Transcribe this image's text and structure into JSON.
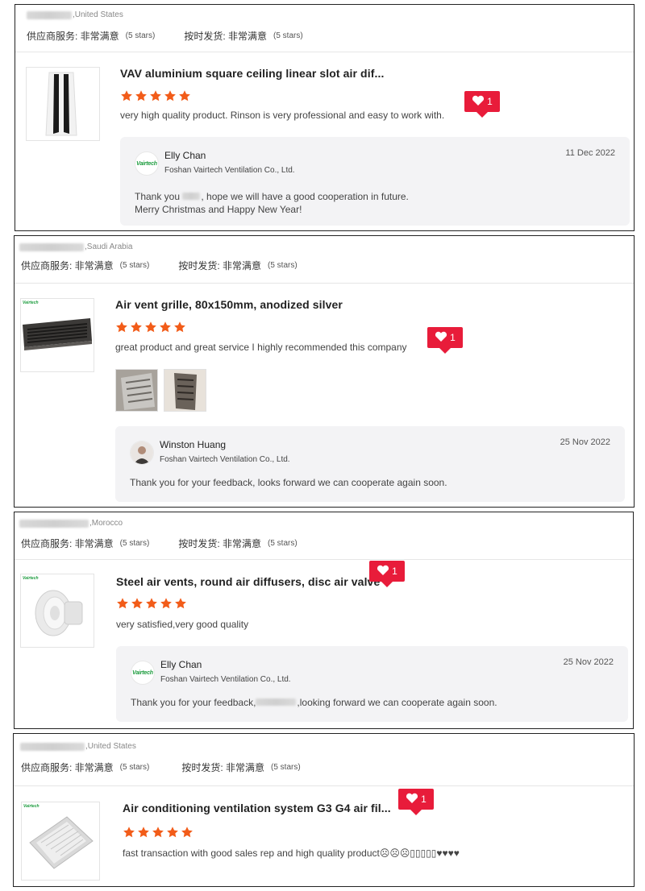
{
  "colors": {
    "star": "#f25c19",
    "like": "#e81c3a",
    "reply_bg": "#f3f3f5",
    "brand_green": "#1a9b3c"
  },
  "brand_logo_text": "Vairtech",
  "reviews": [
    {
      "location": ",United States",
      "service_label": "供应商服务: 非常满意",
      "service_stars": "(5 stars)",
      "shipping_label": "按时发货: 非常满意",
      "shipping_stars": "(5 stars)",
      "product_title": "VAV aluminium square ceiling linear slot air dif...",
      "rating": 5,
      "comment": "very high quality product.  Rinson is very professional and easy to work with.",
      "likes": "1",
      "reply": {
        "name": "Elly Chan",
        "company": "Foshan Vairtech Ventilation Co., Ltd.",
        "date": "11 Dec 2022",
        "line1_a": "Thank you ",
        "line1_b": ", hope we will have a good cooperation in future.",
        "line2": "Merry Christmas and Happy New Year!"
      }
    },
    {
      "location": ",Saudi Arabia",
      "service_label": "供应商服务: 非常满意",
      "service_stars": "(5 stars)",
      "shipping_label": "按时发货: 非常满意",
      "shipping_stars": "(5 stars)",
      "product_title": "Air vent grille, 80x150mm, anodized silver",
      "rating": 5,
      "comment": "great product and great service I highly recommended this company",
      "likes": "1",
      "reply": {
        "name": "Winston Huang",
        "company": "Foshan Vairtech Ventilation Co., Ltd.",
        "date": "25 Nov 2022",
        "line1": "Thank you for your feedback, looks forward we can cooperate again soon."
      }
    },
    {
      "location": ",Morocco",
      "service_label": "供应商服务: 非常满意",
      "service_stars": "(5 stars)",
      "shipping_label": "按时发货: 非常满意",
      "shipping_stars": "(5 stars)",
      "product_title": "Steel air vents, round air diffusers, disc air valve",
      "rating": 5,
      "comment": "very satisfied,very good quality",
      "likes": "1",
      "reply": {
        "name": "Elly Chan",
        "company": "Foshan Vairtech Ventilation Co., Ltd.",
        "date": "25 Nov 2022",
        "line1_a": "Thank you for your feedback,",
        "line1_b": ",looking forward we can cooperate again soon."
      }
    },
    {
      "location": ",United States",
      "service_label": "供应商服务: 非常满意",
      "service_stars": "(5 stars)",
      "shipping_label": "按时发货: 非常满意",
      "shipping_stars": "(5 stars)",
      "product_title": "Air conditioning ventilation system G3 G4 air fil...",
      "rating": 5,
      "comment": "fast transaction with good sales rep and high quality product☹☹☹▯▯▯▯▯♥♥♥♥",
      "likes": "1"
    }
  ]
}
